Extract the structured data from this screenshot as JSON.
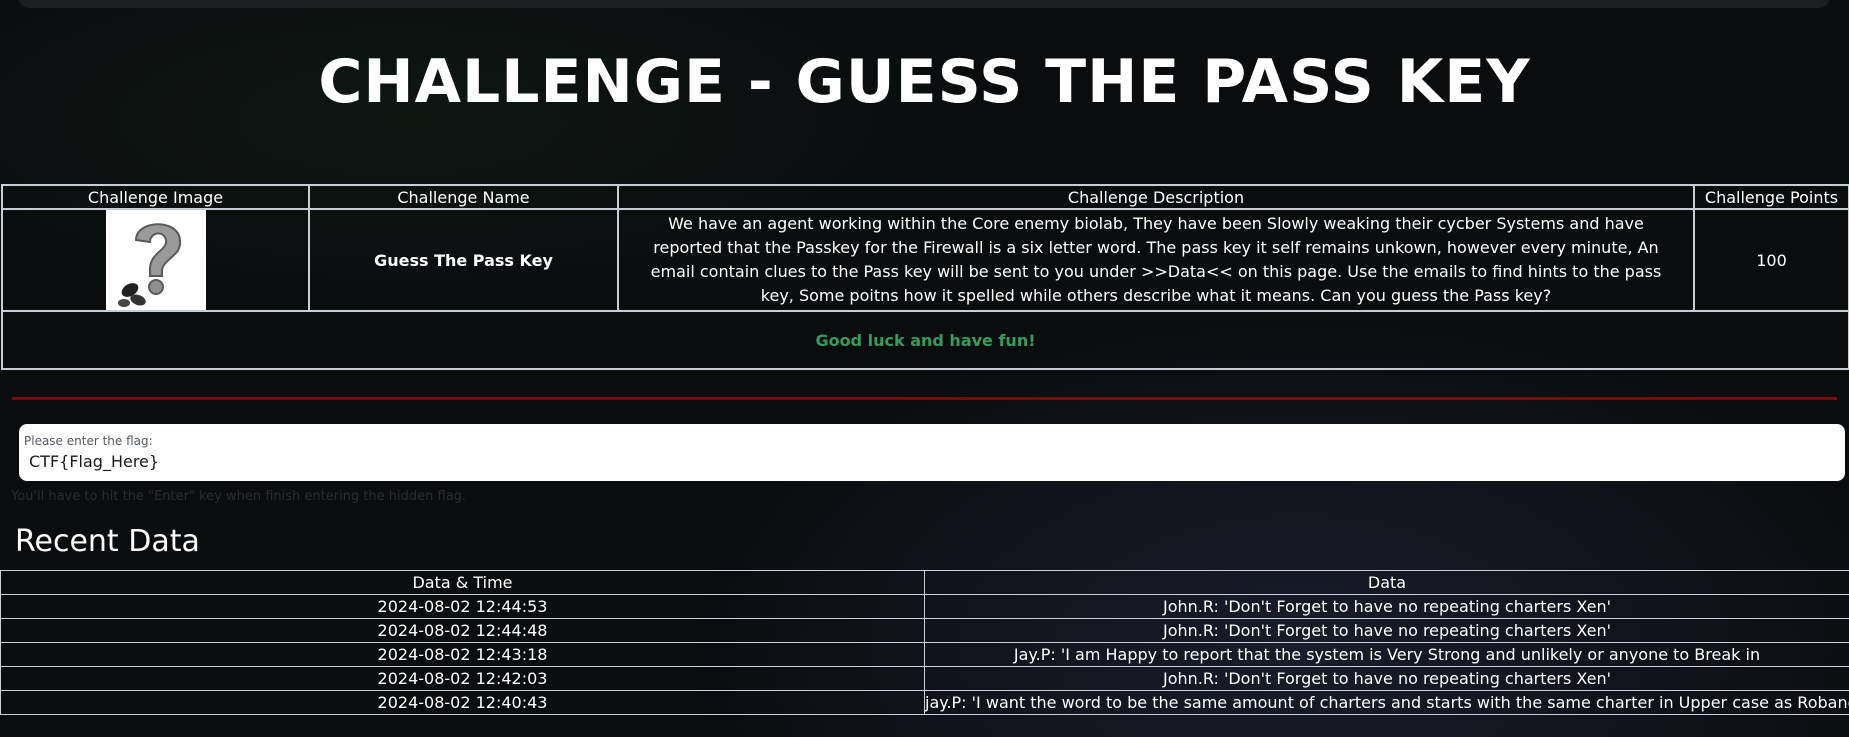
{
  "page": {
    "title": "CHALLENGE - GUESS THE PASS KEY"
  },
  "challenge_table": {
    "headers": [
      "Challenge Image",
      "Challenge Name",
      "Challenge Description",
      "Challenge Points"
    ],
    "name": "Guess The Pass Key",
    "description": "We have an agent working within the Core enemy biolab, They have been Slowly weaking their cycber Systems and have reported that the Passkey for the Firewall is a six letter word. The pass key it self remains unkown, however every minute, An email contain clues to the Pass key will be sent to you under >>Data<< on this page. Use the emails to find hints to the pass key, Some poitns how it spelled while others describe what it means. Can you guess the Pass key?",
    "points": "100",
    "image_icon": "question-mark-icon",
    "footer": "Good luck and have fun!"
  },
  "flag_form": {
    "label": "Please enter the flag:",
    "placeholder": "CTF{Flag_Here}",
    "hint": "You'll have to hit the \"Enter\" key when finish entering the hidden flag."
  },
  "recent": {
    "title": "Recent Data",
    "headers": [
      "Data & Time",
      "Data"
    ],
    "rows": [
      {
        "time": "2024-08-02 12:44:53",
        "data": "John.R: 'Don't Forget to have no repeating charters Xen'"
      },
      {
        "time": "2024-08-02 12:44:48",
        "data": "John.R: 'Don't Forget to have no repeating charters Xen'"
      },
      {
        "time": "2024-08-02 12:43:18",
        "data": "Jay.P: 'I am Happy to report that the system is Very Strong and unlikely or anyone to Break in"
      },
      {
        "time": "2024-08-02 12:42:03",
        "data": "John.R: 'Don't Forget to have no repeating charters Xen'"
      },
      {
        "time": "2024-08-02 12:40:43",
        "data": "jay.P: 'I want the word to be the same amount of charters and starts with the same charter in Upper case as Roband"
      }
    ]
  },
  "colors": {
    "background": "#0a0c0e",
    "accent_green": "#2f9e5e",
    "divider_red": "#6f0f12",
    "table_border": "#c9ced6"
  }
}
